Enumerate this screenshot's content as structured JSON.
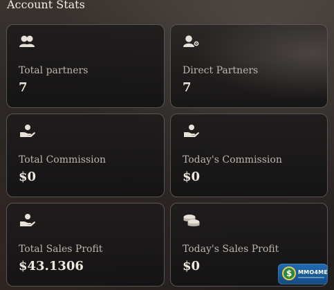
{
  "section": {
    "title": "Account Stats"
  },
  "stats": [
    {
      "icon": "users-icon",
      "label": "Total partners",
      "value": "7"
    },
    {
      "icon": "user-gear-icon",
      "label": "Direct Partners",
      "value": "7"
    },
    {
      "icon": "hand-coin-icon",
      "label": "Total Commission",
      "value": "$0"
    },
    {
      "icon": "hand-coin-icon",
      "label": "Today's Commission",
      "value": "$0"
    },
    {
      "icon": "hand-coin-icon",
      "label": "Total Sales Profit",
      "value": "$43.1306"
    },
    {
      "icon": "coins-stack-icon",
      "label": "Today's Sales Profit",
      "value": "$0"
    }
  ],
  "badge": {
    "symbol": "$",
    "text": "MMO4ME",
    "colors": {
      "background": "#1f6db3",
      "coin": "#2a8a3c",
      "ring": "#f2c94c"
    }
  }
}
